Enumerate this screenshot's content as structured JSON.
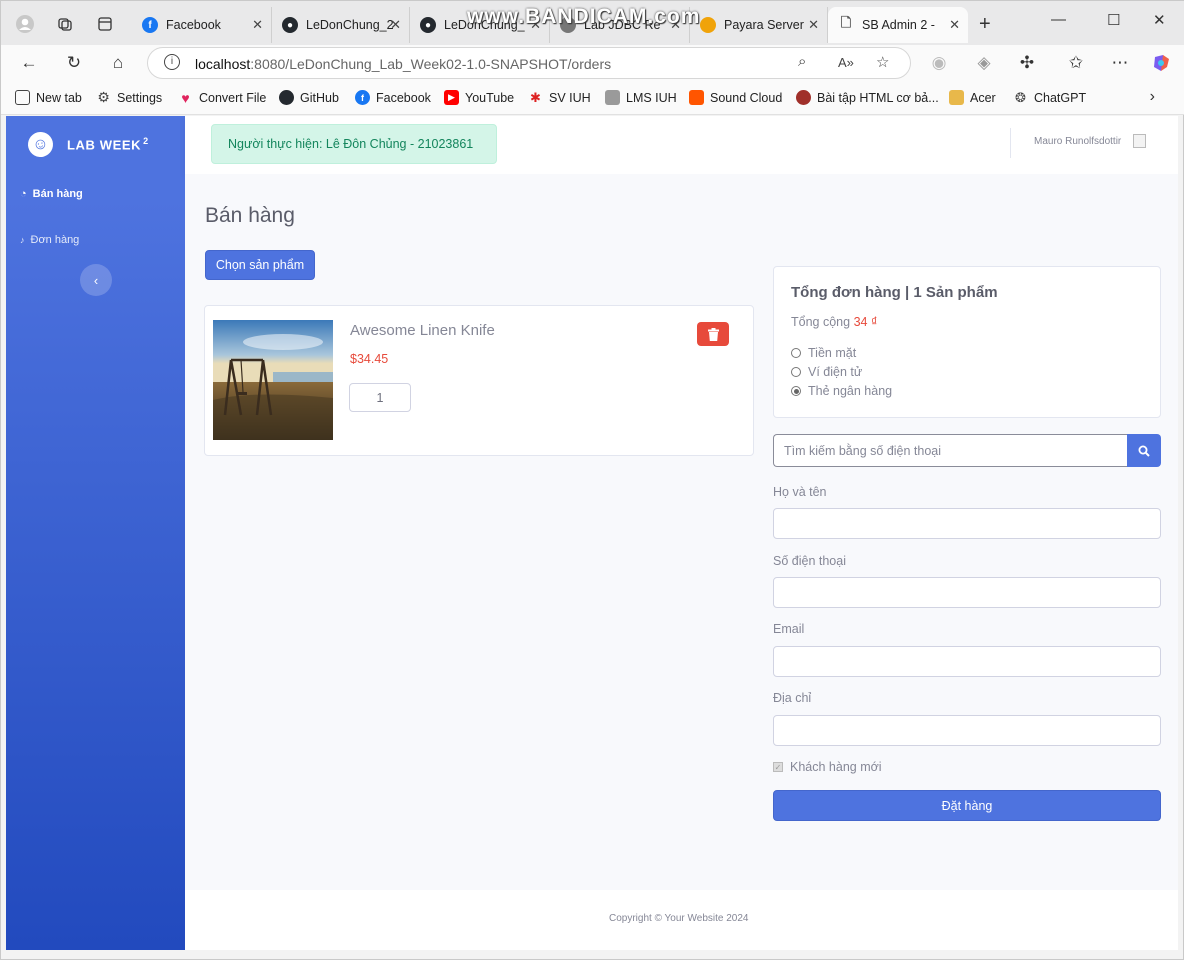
{
  "browser": {
    "watermark": "www.BANDICAM.com",
    "tabs": [
      {
        "title": "Facebook",
        "icon": "facebook-icon",
        "color": "#1877f2"
      },
      {
        "title": "LeDonChung_2",
        "icon": "github-icon",
        "color": "#24292f"
      },
      {
        "title": "LeDonChung_",
        "icon": "github-icon",
        "color": "#24292f"
      },
      {
        "title": "Lab JDBC Re",
        "icon": "page-icon",
        "color": "#777777"
      },
      {
        "title": "Payara Server",
        "icon": "page-icon",
        "color": "#f0a30a"
      },
      {
        "title": "SB Admin 2 -",
        "icon": "document-icon",
        "color": "#555555"
      }
    ],
    "url_host": "localhost",
    "url_rest": ":8080/LeDonChung_Lab_Week02-1.0-SNAPSHOT/orders",
    "bookmarks": [
      {
        "label": "New tab",
        "color": "#555555"
      },
      {
        "label": "Settings",
        "color": "#555555"
      },
      {
        "label": "Convert File",
        "color": "#e0245e"
      },
      {
        "label": "GitHub",
        "color": "#24292f"
      },
      {
        "label": "Facebook",
        "color": "#1877f2"
      },
      {
        "label": "YouTube",
        "color": "#ff0000"
      },
      {
        "label": "SV IUH",
        "color": "#d22"
      },
      {
        "label": "LMS IUH",
        "color": "#8a8a8a"
      },
      {
        "label": "Sound Cloud",
        "color": "#ff5500"
      },
      {
        "label": "Bài tập HTML cơ bả...",
        "color": "#a0302a"
      },
      {
        "label": "Acer",
        "color": "#e8b84a"
      },
      {
        "label": "ChatGPT",
        "color": "#444444"
      }
    ]
  },
  "sidebar": {
    "brand": "LAB WEEK",
    "brand_sup": "2",
    "items": [
      {
        "label": "Bán hàng"
      },
      {
        "label": "Đơn hàng"
      }
    ]
  },
  "topbar": {
    "alert": "Người thực hiện: Lê Đôn Chủng - 21023861",
    "user_name": "Mauro Runolfsdottir"
  },
  "page": {
    "title": "Bán hàng",
    "choose_button": "Chọn sản phẩm"
  },
  "product": {
    "name": "Awesome Linen Knife",
    "price": "$34.45",
    "quantity": "1"
  },
  "summary": {
    "title": "Tổng đơn hàng | 1 Sản phẩm",
    "total_label": "Tổng cộng",
    "total_value": "34 ₫",
    "payment_options": [
      {
        "label": "Tiền mặt",
        "selected": false
      },
      {
        "label": "Ví điện tử",
        "selected": false
      },
      {
        "label": "Thẻ ngân hàng",
        "selected": true
      }
    ]
  },
  "customer_form": {
    "search_placeholder": "Tìm kiếm bằng số điện thoại",
    "name_label": "Họ và tên",
    "phone_label": "Số điện thoại",
    "email_label": "Email",
    "address_label": "Địa chỉ",
    "new_customer_label": "Khách hàng mới",
    "submit": "Đặt hàng"
  },
  "footer": {
    "copyright": "Copyright © Your Website 2024"
  },
  "colors": {
    "primary": "#4e73df",
    "danger": "#e74a3b",
    "success_bg": "#d4f5e8"
  }
}
